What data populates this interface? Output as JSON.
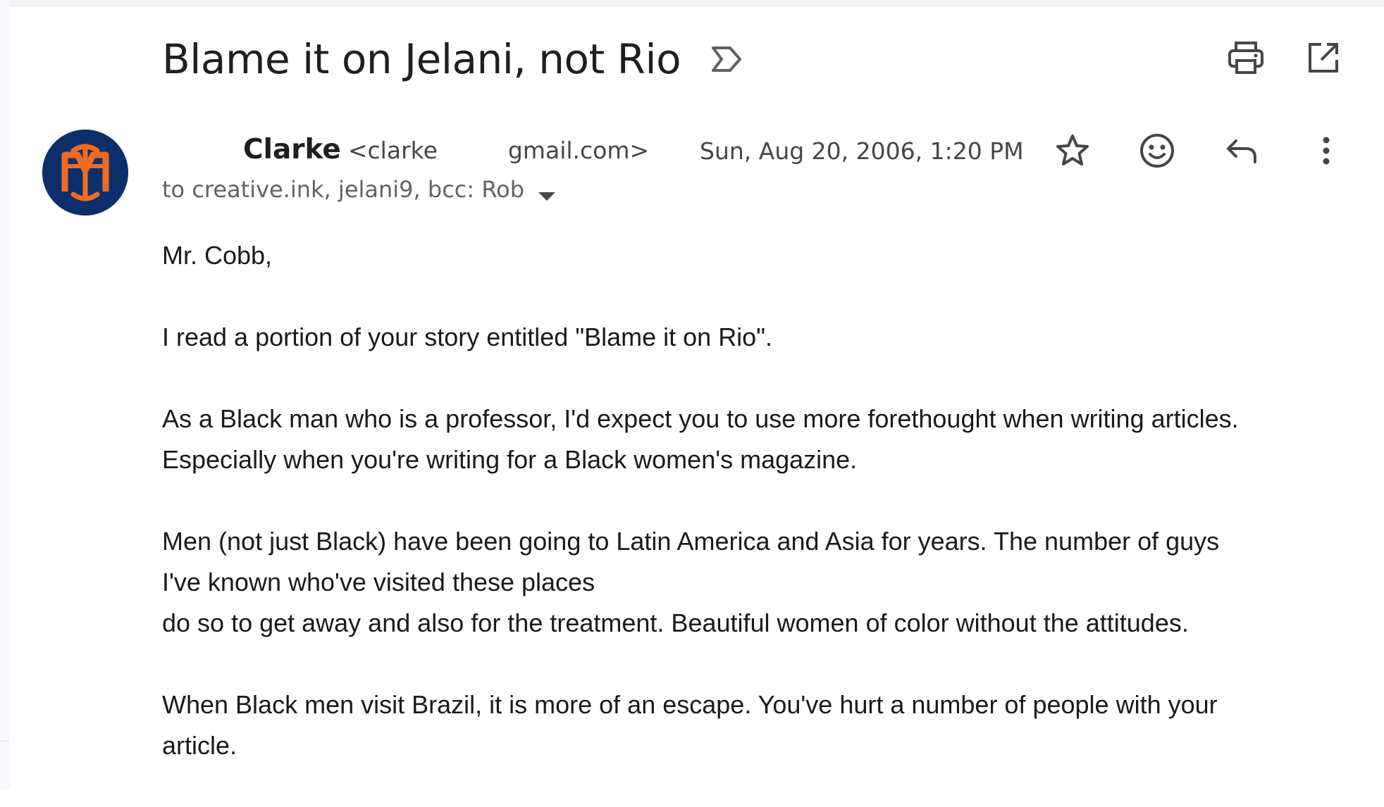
{
  "subject": "Blame it on Jelani, not Rio",
  "icons": {
    "label": "label-icon",
    "print": "print-icon",
    "open_new_window": "open-in-new-window-icon",
    "star": "star-icon",
    "emoji": "emoji-react-icon",
    "reply": "reply-icon",
    "more": "more-vert-icon",
    "recipients_toggle": "dropdown-arrow-icon"
  },
  "sender": {
    "name": "Clarke",
    "email_start": "<clarke",
    "email_end": "gmail.com>",
    "avatar": "mets-logo-avatar"
  },
  "date": "Sun, Aug 20, 2006, 1:20 PM",
  "recipients": "to creative.ink, jelani9, bcc: Rob",
  "body": {
    "greeting": "Mr. Cobb,",
    "p1": "I read a portion of your story entitled \"Blame it on Rio\".",
    "p2_l1": "As a Black man who is a professor, I'd expect you to use more forethought when writing articles.",
    "p2_l2": "Especially when you're writing for a Black women's magazine.",
    "p3_l1": "Men (not just Black) have been going to Latin America and Asia for years. The number of guys",
    "p3_l2": "I've known who've visited these places",
    "p3_l3": "do so to get away and also for the treatment. Beautiful women of color without the attitudes.",
    "p4_l1": "When Black men visit Brazil, it is more of an escape. You've hurt a number of people with your",
    "p4_l2": "article."
  },
  "colors": {
    "avatar_bg": "#0c2f6b",
    "logo_orange": "#f26a21",
    "icon_gray": "#444746"
  }
}
